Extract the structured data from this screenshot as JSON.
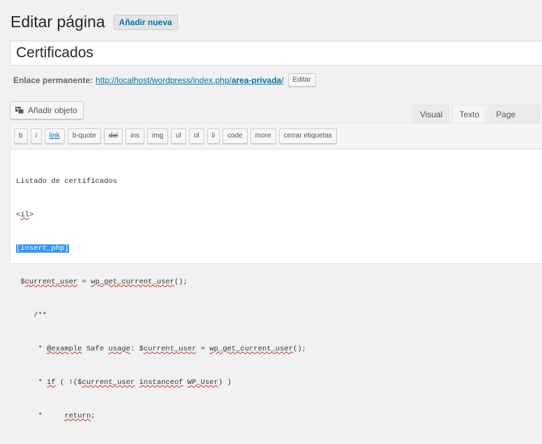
{
  "page": {
    "title": "Editar página",
    "add_new": "Añadir nueva"
  },
  "post_title": "Certificados",
  "permalink": {
    "label": "Enlace permanente:",
    "url_prefix": "http://localhost/wordpress/index.php/",
    "slug": "area-privada",
    "url_suffix": "/",
    "edit_label": "Editar"
  },
  "media_button": {
    "label": "Añadir objeto",
    "icon": "media-icon"
  },
  "editor_tabs": [
    "Visual",
    "Texto",
    "Page Builder"
  ],
  "active_tab": "Texto",
  "quicktags": [
    "b",
    "i",
    "link",
    "b-quote",
    "del",
    "ins",
    "img",
    "ul",
    "ol",
    "li",
    "code",
    "more",
    "cerrar etiquetas"
  ],
  "code": {
    "l1": "Listado de certificados",
    "l2_open": "<",
    "l2_tag": "il",
    "l2_close": ">",
    "l3": "[insert_php]",
    "l4_a": " $",
    "l4_var": "current_user",
    "l4_b": " = ",
    "l4_fn": "wp_get_current_user",
    "l4_c": "();",
    "l5": "    /**",
    "l6_a": "     * ",
    "l6_ex": "@example",
    "l6_b": " Safe ",
    "l6_usage": "usage",
    "l6_c": ": $",
    "l6_var": "current_user",
    "l6_d": " = ",
    "l6_fn": "wp_get_current_user",
    "l6_e": "();",
    "l7_a": "     * ",
    "l7_if": "if",
    "l7_b": " ( !($",
    "l7_var": "current_user",
    "l7_c": " ",
    "l7_inst": "instanceof",
    "l7_d": " ",
    "l7_cls": "WP_User",
    "l7_e": ") )",
    "l8_a": "     *     ",
    "l8_ret": "return",
    "l8_b": ";"
  }
}
